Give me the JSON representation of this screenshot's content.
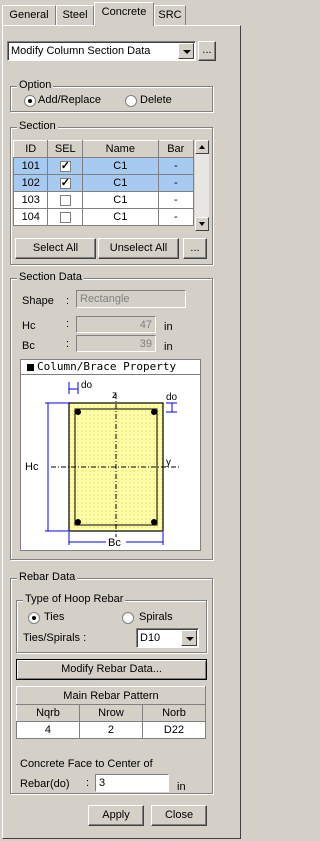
{
  "tabs": [
    "General",
    "Steel",
    "Concrete",
    "SRC"
  ],
  "active_tab": "Concrete",
  "mode_select": {
    "value": "Modify Column Section Data",
    "more": "..."
  },
  "option": {
    "title": "Option",
    "add": "Add/Replace",
    "delete": "Delete",
    "selected": "add"
  },
  "section": {
    "title": "Section",
    "columns": [
      "ID",
      "SEL",
      "Name",
      "Bar"
    ],
    "rows": [
      {
        "id": "101",
        "sel": true,
        "name": "C1",
        "bar": "-"
      },
      {
        "id": "102",
        "sel": true,
        "name": "C1",
        "bar": "-"
      },
      {
        "id": "103",
        "sel": false,
        "name": "C1",
        "bar": "-"
      },
      {
        "id": "104",
        "sel": false,
        "name": "C1",
        "bar": "-"
      }
    ],
    "select_all": "Select All",
    "unselect_all": "Unselect All",
    "more": "..."
  },
  "section_data": {
    "title": "Section Data",
    "shape_label": "Shape",
    "colon": ":",
    "shape_value": "Rectangle",
    "hc_label": "Hc",
    "hc_value": "47",
    "hc_unit": "in",
    "bc_label": "Bc",
    "bc_value": "39",
    "bc_unit": "in"
  },
  "diagram": {
    "title": "Column/Brace Property",
    "do_label": "do",
    "z_label": "z",
    "y_label": "y",
    "hc_label": "Hc",
    "bc_label": "Bc"
  },
  "rebar": {
    "title": "Rebar Data",
    "hoop_title": "Type of Hoop Rebar",
    "ties": "Ties",
    "spirals": "Spirals",
    "selected": "ties",
    "ties_spirals_label": "Ties/Spirals :",
    "ties_spirals_value": "D10",
    "modify_button": "Modify Rebar Data...",
    "pattern_title": "Main Rebar Pattern",
    "pattern_cols": [
      "Nqrb",
      "Nrow",
      "Norb"
    ],
    "pattern_vals": [
      "4",
      "2",
      "D22"
    ],
    "cover_label1": "Concrete Face to Center of",
    "cover_label2": "Rebar(do)",
    "cover_colon": ":",
    "cover_value": "3",
    "cover_unit": "in"
  },
  "footer": {
    "apply": "Apply",
    "close": "Close"
  },
  "colors": {
    "selected_row": "#a6caf0",
    "concrete_fill": "#ffffa8",
    "dim_blue": "#0000ff"
  }
}
